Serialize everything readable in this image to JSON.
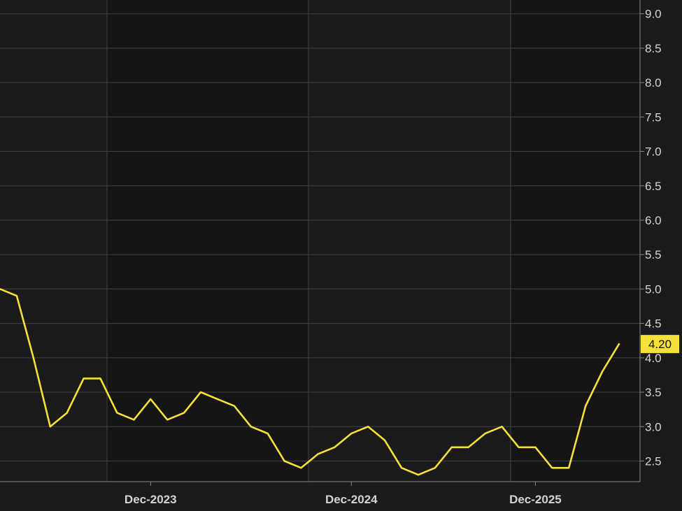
{
  "chart_data": {
    "type": "line",
    "title": "",
    "xlabel": "",
    "ylabel": "",
    "ylim": [
      2.2,
      9.2
    ],
    "y_ticks": [
      "2.5",
      "3.0",
      "3.5",
      "4.0",
      "4.5",
      "5.0",
      "5.5",
      "6.0",
      "6.5",
      "7.0",
      "7.5",
      "8.0",
      "8.5",
      "9.0"
    ],
    "x_ticks": [
      {
        "label": "Dec-2023",
        "index": 9
      },
      {
        "label": "Dec-2024",
        "index": 21
      },
      {
        "label": "Dec-2025",
        "index": 32
      }
    ],
    "x_range": [
      0,
      37
    ],
    "grid": true,
    "legend": "none",
    "last_value_label": "4.20",
    "series": [
      {
        "values": [
          5.0,
          4.9,
          4.0,
          3.0,
          3.2,
          3.7,
          3.7,
          3.2,
          3.1,
          3.4,
          3.1,
          3.2,
          3.5,
          3.4,
          3.3,
          3.0,
          2.9,
          2.5,
          2.4,
          2.6,
          2.7,
          2.9,
          3.0,
          2.8,
          2.4,
          2.3,
          2.4,
          2.7,
          2.7,
          2.9,
          3.0,
          2.7,
          2.7,
          2.4,
          2.4,
          3.3,
          3.8,
          4.2
        ]
      }
    ],
    "colors": {
      "line": "#f5e13a",
      "grid": "#3a3a3a",
      "background": "#1b1b1b",
      "band_dark": "#151515",
      "axis": "#8a8a8a",
      "label_bg": "#f5e13a"
    }
  }
}
